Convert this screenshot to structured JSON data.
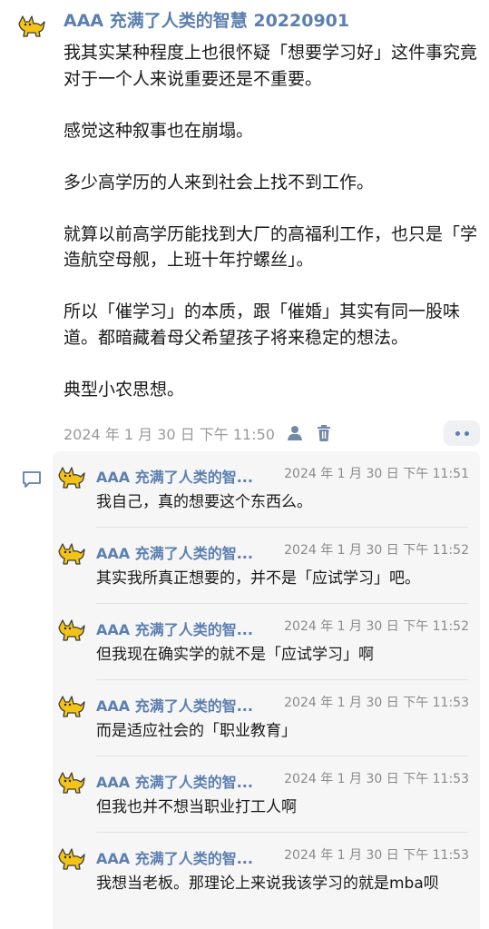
{
  "post": {
    "author": "AAA 充满了人类的智慧 20220901",
    "paragraphs": [
      "我其实某种程度上也很怀疑「想要学习好」这件事究竟对于一个人来说重要还是不重要。",
      "感觉这种叙事也在崩塌。",
      "多少高学历的人来到社会上找不到工作。",
      "就算以前高学历能找到大厂的高福利工作，也只是「学造航空母舰，上班十年拧螺丝」。",
      "所以「催学习」的本质，跟「催婚」其实有同一股味道。都暗藏着母父希望孩子将来稳定的想法。",
      "典型小农思想。"
    ],
    "timestamp": "2024 年 1 月 30 日  下午 11:50",
    "icons": {
      "visibility": "person-icon",
      "delete": "trash-icon",
      "more": "more-dots-icon"
    }
  },
  "comments_icon": "comment-bubble-icon",
  "comments": [
    {
      "author": "AAA 充满了人类的智...",
      "time": "2024 年 1 月 30 日  下午 11:51",
      "text": "我自己，真的想要这个东西么。"
    },
    {
      "author": "AAA 充满了人类的智...",
      "time": "2024 年 1 月 30 日  下午 11:52",
      "text": "其实我所真正想要的，并不是「应试学习」吧。"
    },
    {
      "author": "AAA 充满了人类的智...",
      "time": "2024 年 1 月 30 日  下午 11:52",
      "text": "但我现在确实学的就不是「应试学习」啊"
    },
    {
      "author": "AAA 充满了人类的智...",
      "time": "2024 年 1 月 30 日  下午 11:53",
      "text": "而是适应社会的「职业教育」"
    },
    {
      "author": "AAA 充满了人类的智...",
      "time": "2024 年 1 月 30 日  下午 11:53",
      "text": "但我也并不想当职业打工人啊"
    },
    {
      "author": "AAA 充满了人类的智...",
      "time": "2024 年 1 月 30 日  下午 11:53",
      "text": "我想当老板。那理论上来说我该学习的就是mba呗"
    }
  ],
  "colors": {
    "name": "#5b7fb0",
    "meta": "#999999",
    "panel": "#f6f6f6",
    "avatar_yellow": "#f3c316"
  }
}
